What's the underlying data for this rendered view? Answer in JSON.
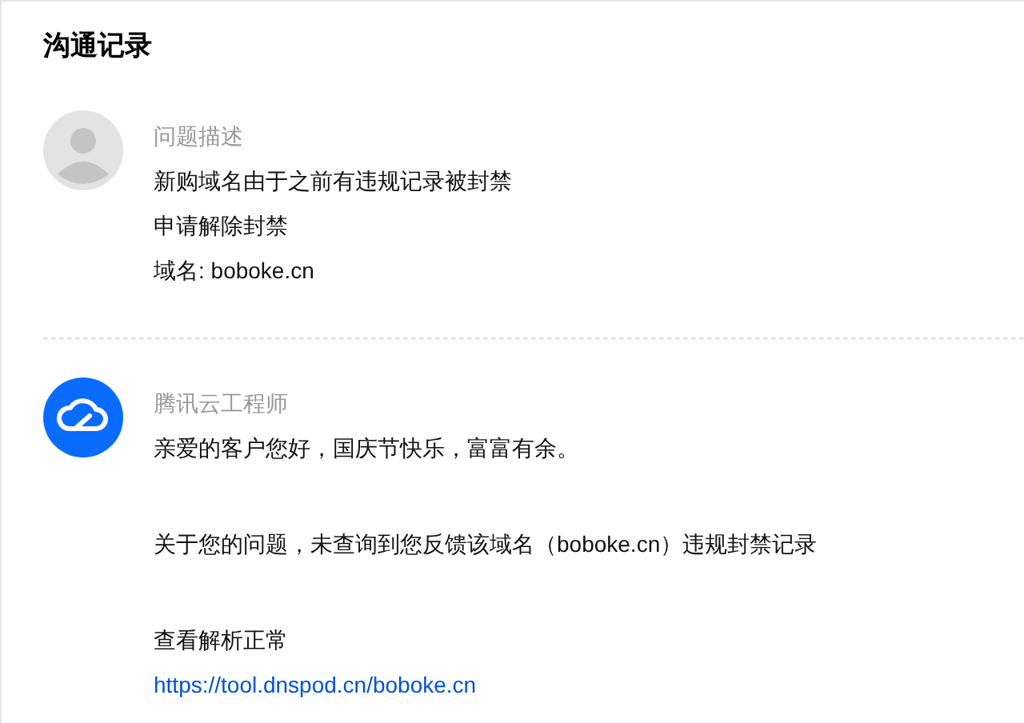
{
  "title": "沟通记录",
  "messages": [
    {
      "kind": "customer",
      "author": "问题描述",
      "paragraphs": [
        [
          {
            "kind": "text",
            "text": "新购域名由于之前有违规记录被封禁"
          },
          {
            "kind": "text",
            "text": "申请解除封禁"
          },
          {
            "kind": "text",
            "text": "域名: boboke.cn"
          }
        ]
      ]
    },
    {
      "kind": "engineer",
      "author": "腾讯云工程师",
      "paragraphs": [
        [
          {
            "kind": "text",
            "text": "亲爱的客户您好，国庆节快乐，富富有余。"
          }
        ],
        [
          {
            "kind": "text",
            "text": "关于您的问题，未查询到您反馈该域名（boboke.cn）违规封禁记录"
          }
        ],
        [
          {
            "kind": "text",
            "text": "查看解析正常"
          },
          {
            "kind": "link",
            "text": "https://tool.dnspod.cn/boboke.cn"
          }
        ]
      ]
    }
  ]
}
